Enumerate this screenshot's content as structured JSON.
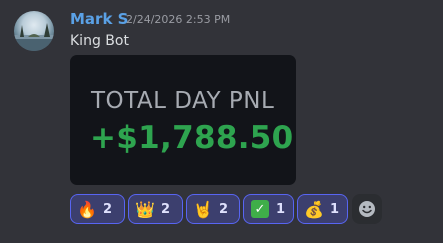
{
  "message": {
    "author": "Mark S",
    "timestamp": "2/24/2026 2:53 PM",
    "text": "King Bot"
  },
  "embed": {
    "label": "TOTAL DAY PNL",
    "value": "+$1,788.50"
  },
  "reactions": [
    {
      "emoji": "fire",
      "glyph": "🔥",
      "count": "2"
    },
    {
      "emoji": "crown",
      "glyph": "👑",
      "count": "2"
    },
    {
      "emoji": "sign-of-horns",
      "glyph": "🤘",
      "count": "2"
    },
    {
      "emoji": "check-mark",
      "glyph": "✓",
      "count": "1"
    },
    {
      "emoji": "money-bag",
      "glyph": "💰",
      "count": "1"
    }
  ],
  "colors": {
    "background": "#323339",
    "username": "#5aa1e6",
    "pnl_positive": "#2ea44f",
    "reaction_bg": "#3c3f6e",
    "reaction_border": "#5865f2"
  }
}
